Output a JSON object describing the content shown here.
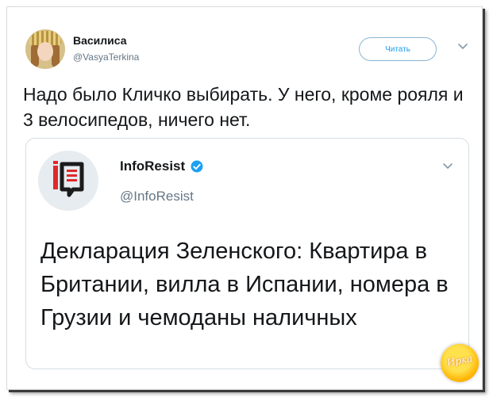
{
  "author": {
    "name": "Василиса",
    "handle": "@VasyaTerkina"
  },
  "follow_button": {
    "label": "Читать"
  },
  "tweet": {
    "text": "Надо было Кличко выбирать. У него, кроме рояля и 3 велосипедов, ничего нет."
  },
  "quoted_tweet": {
    "name": "InfoResist",
    "handle": "@InfoResist",
    "text": "Декларация Зеленского: Квартира в Британии, вилла в Испании, номера в Грузии и чемоданы наличных"
  },
  "watermark": {
    "text": "Ирка"
  },
  "colors": {
    "accent": "#1da1f2",
    "text": "#14171a",
    "muted": "#657786",
    "logo_red": "#e0292a"
  },
  "icons": {
    "chevron": "chevron-down-icon",
    "verified": "verified-badge-icon"
  }
}
